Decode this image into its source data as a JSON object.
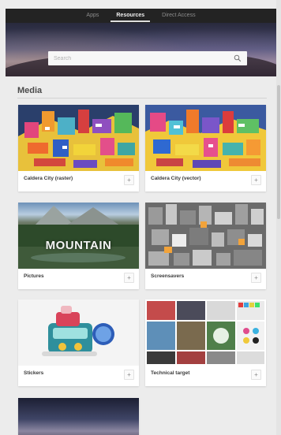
{
  "nav": {
    "tabs": [
      {
        "label": "Apps"
      },
      {
        "label": "Resources",
        "active": true
      },
      {
        "label": "Direct Access"
      }
    ]
  },
  "search": {
    "placeholder": "Search",
    "icon": "search-icon"
  },
  "section": {
    "title": "Media"
  },
  "cards": [
    {
      "label": "Caldera City (raster)",
      "button": "+"
    },
    {
      "label": "Caldera City (vector)",
      "button": "+"
    },
    {
      "label": "Pictures",
      "overlay_text": "MOUNTAIN",
      "button": "+"
    },
    {
      "label": "Screensavers",
      "button": "+"
    },
    {
      "label": "Stickers",
      "button": "+"
    },
    {
      "label": "Technical target",
      "button": "+"
    },
    {
      "label": "",
      "button": ""
    }
  ],
  "colors": {
    "page_bg": "#ececec",
    "tab_bar": "#232323",
    "card_bg": "#ffffff"
  }
}
